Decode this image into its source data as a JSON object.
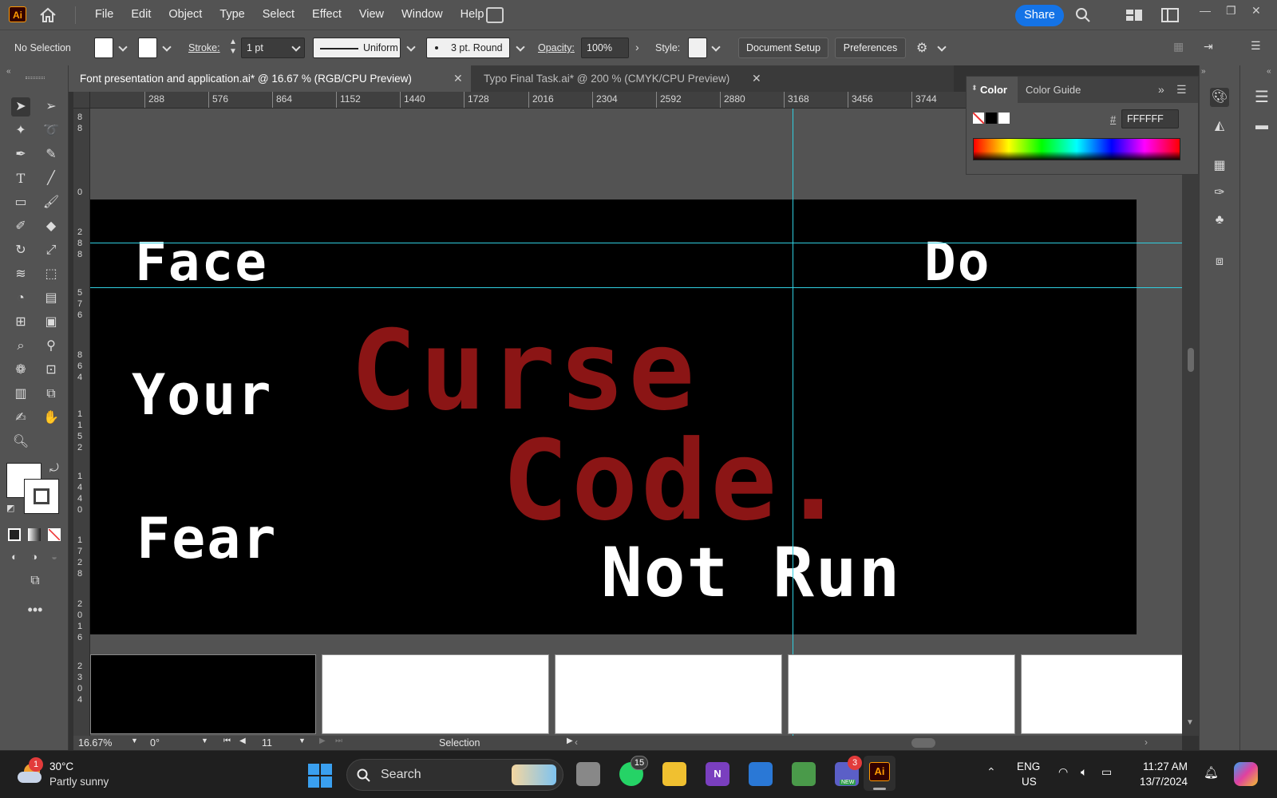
{
  "app": {
    "logo": "Ai",
    "menus": [
      "File",
      "Edit",
      "Object",
      "Type",
      "Select",
      "Effect",
      "View",
      "Window",
      "Help"
    ],
    "share_label": "Share"
  },
  "control_bar": {
    "selection_label": "No Selection",
    "stroke_label": "Stroke:",
    "stroke_value": "1 pt",
    "profile_label": "Uniform",
    "brush_label": "3 pt. Round",
    "opacity_label": "Opacity:",
    "opacity_value": "100%",
    "style_label": "Style:",
    "document_setup_label": "Document Setup",
    "preferences_label": "Preferences"
  },
  "tabs": [
    {
      "label": "Font presentation and application.ai* @ 16.67 % (RGB/CPU Preview)",
      "active": true
    },
    {
      "label": "Typo Final Task.ai* @ 200 % (CMYK/CPU Preview)",
      "active": false
    }
  ],
  "ruler": {
    "h_ticks": [
      "288",
      "576",
      "864",
      "1152",
      "1440",
      "1728",
      "2016",
      "2304",
      "2592",
      "2880",
      "3168",
      "3456",
      "3744"
    ],
    "v_numbers": [
      "8\n8",
      "0",
      "2\n8\n8",
      "5\n7\n6",
      "8\n6\n4",
      "1\n1\n5\n2",
      "1\n4\n4\n0",
      "1\n7\n2\n8",
      "2\n0\n1\n6",
      "2\n3\n0\n4"
    ]
  },
  "artboard": {
    "words": [
      "Face",
      "Do",
      "Your",
      "Curse",
      "Code.",
      "Fear",
      "Not Run"
    ],
    "background": "#000000",
    "white_text": "#ffffff",
    "accent_text": "#8b1515"
  },
  "color_panel": {
    "tab_color": "Color",
    "tab_color_guide": "Color Guide",
    "hex_symbol": "#",
    "hex_value": "FFFFFF"
  },
  "status_bar": {
    "zoom": "16.67%",
    "rotation": "0°",
    "artboard_number": "11",
    "tool_status": "Selection"
  },
  "taskbar": {
    "weather_temp": "30°C",
    "weather_desc": "Partly sunny",
    "weather_badge": "1",
    "search_placeholder": "Search",
    "whatsapp_badge": "15",
    "teams_badge": "3",
    "teams_tag": "NEW",
    "language_line1": "ENG",
    "language_line2": "US",
    "time": "11:27 AM",
    "date": "13/7/2024"
  },
  "colors": {
    "accent_blue": "#1473e6",
    "guide_cyan": "#30cfe0",
    "ui_gray": "#535353"
  }
}
